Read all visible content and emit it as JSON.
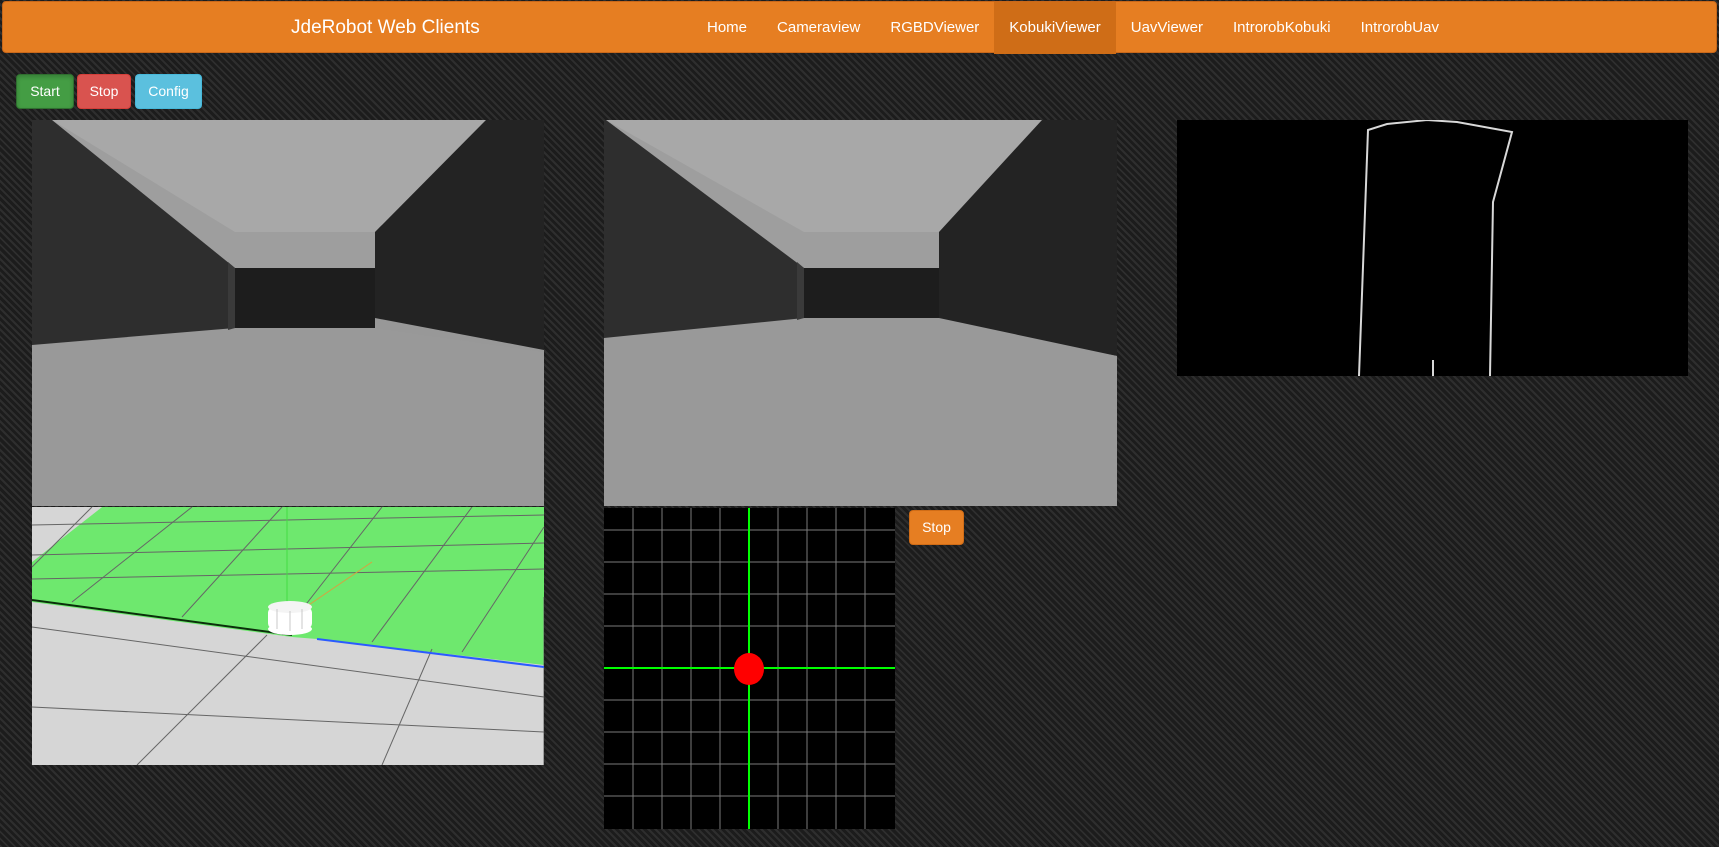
{
  "navbar": {
    "brand": "JdeRobot Web Clients",
    "items": [
      {
        "label": "Home",
        "active": false
      },
      {
        "label": "Cameraview",
        "active": false
      },
      {
        "label": "RGBDViewer",
        "active": false
      },
      {
        "label": "KobukiViewer",
        "active": true
      },
      {
        "label": "UavViewer",
        "active": false
      },
      {
        "label": "IntrorobKobuki",
        "active": false
      },
      {
        "label": "IntrorobUav",
        "active": false
      }
    ]
  },
  "controls": {
    "start_label": "Start",
    "stop_label": "Stop",
    "config_label": "Config"
  },
  "teleop": {
    "stop_label": "Stop",
    "pointer_color": "#ff0000",
    "crosshair_color": "#00ff00"
  },
  "colors": {
    "navbar": "#e67e22",
    "start": "#449d44",
    "stop": "#d9534f",
    "config": "#5bc0de",
    "floor_green": "#6ee86e"
  }
}
